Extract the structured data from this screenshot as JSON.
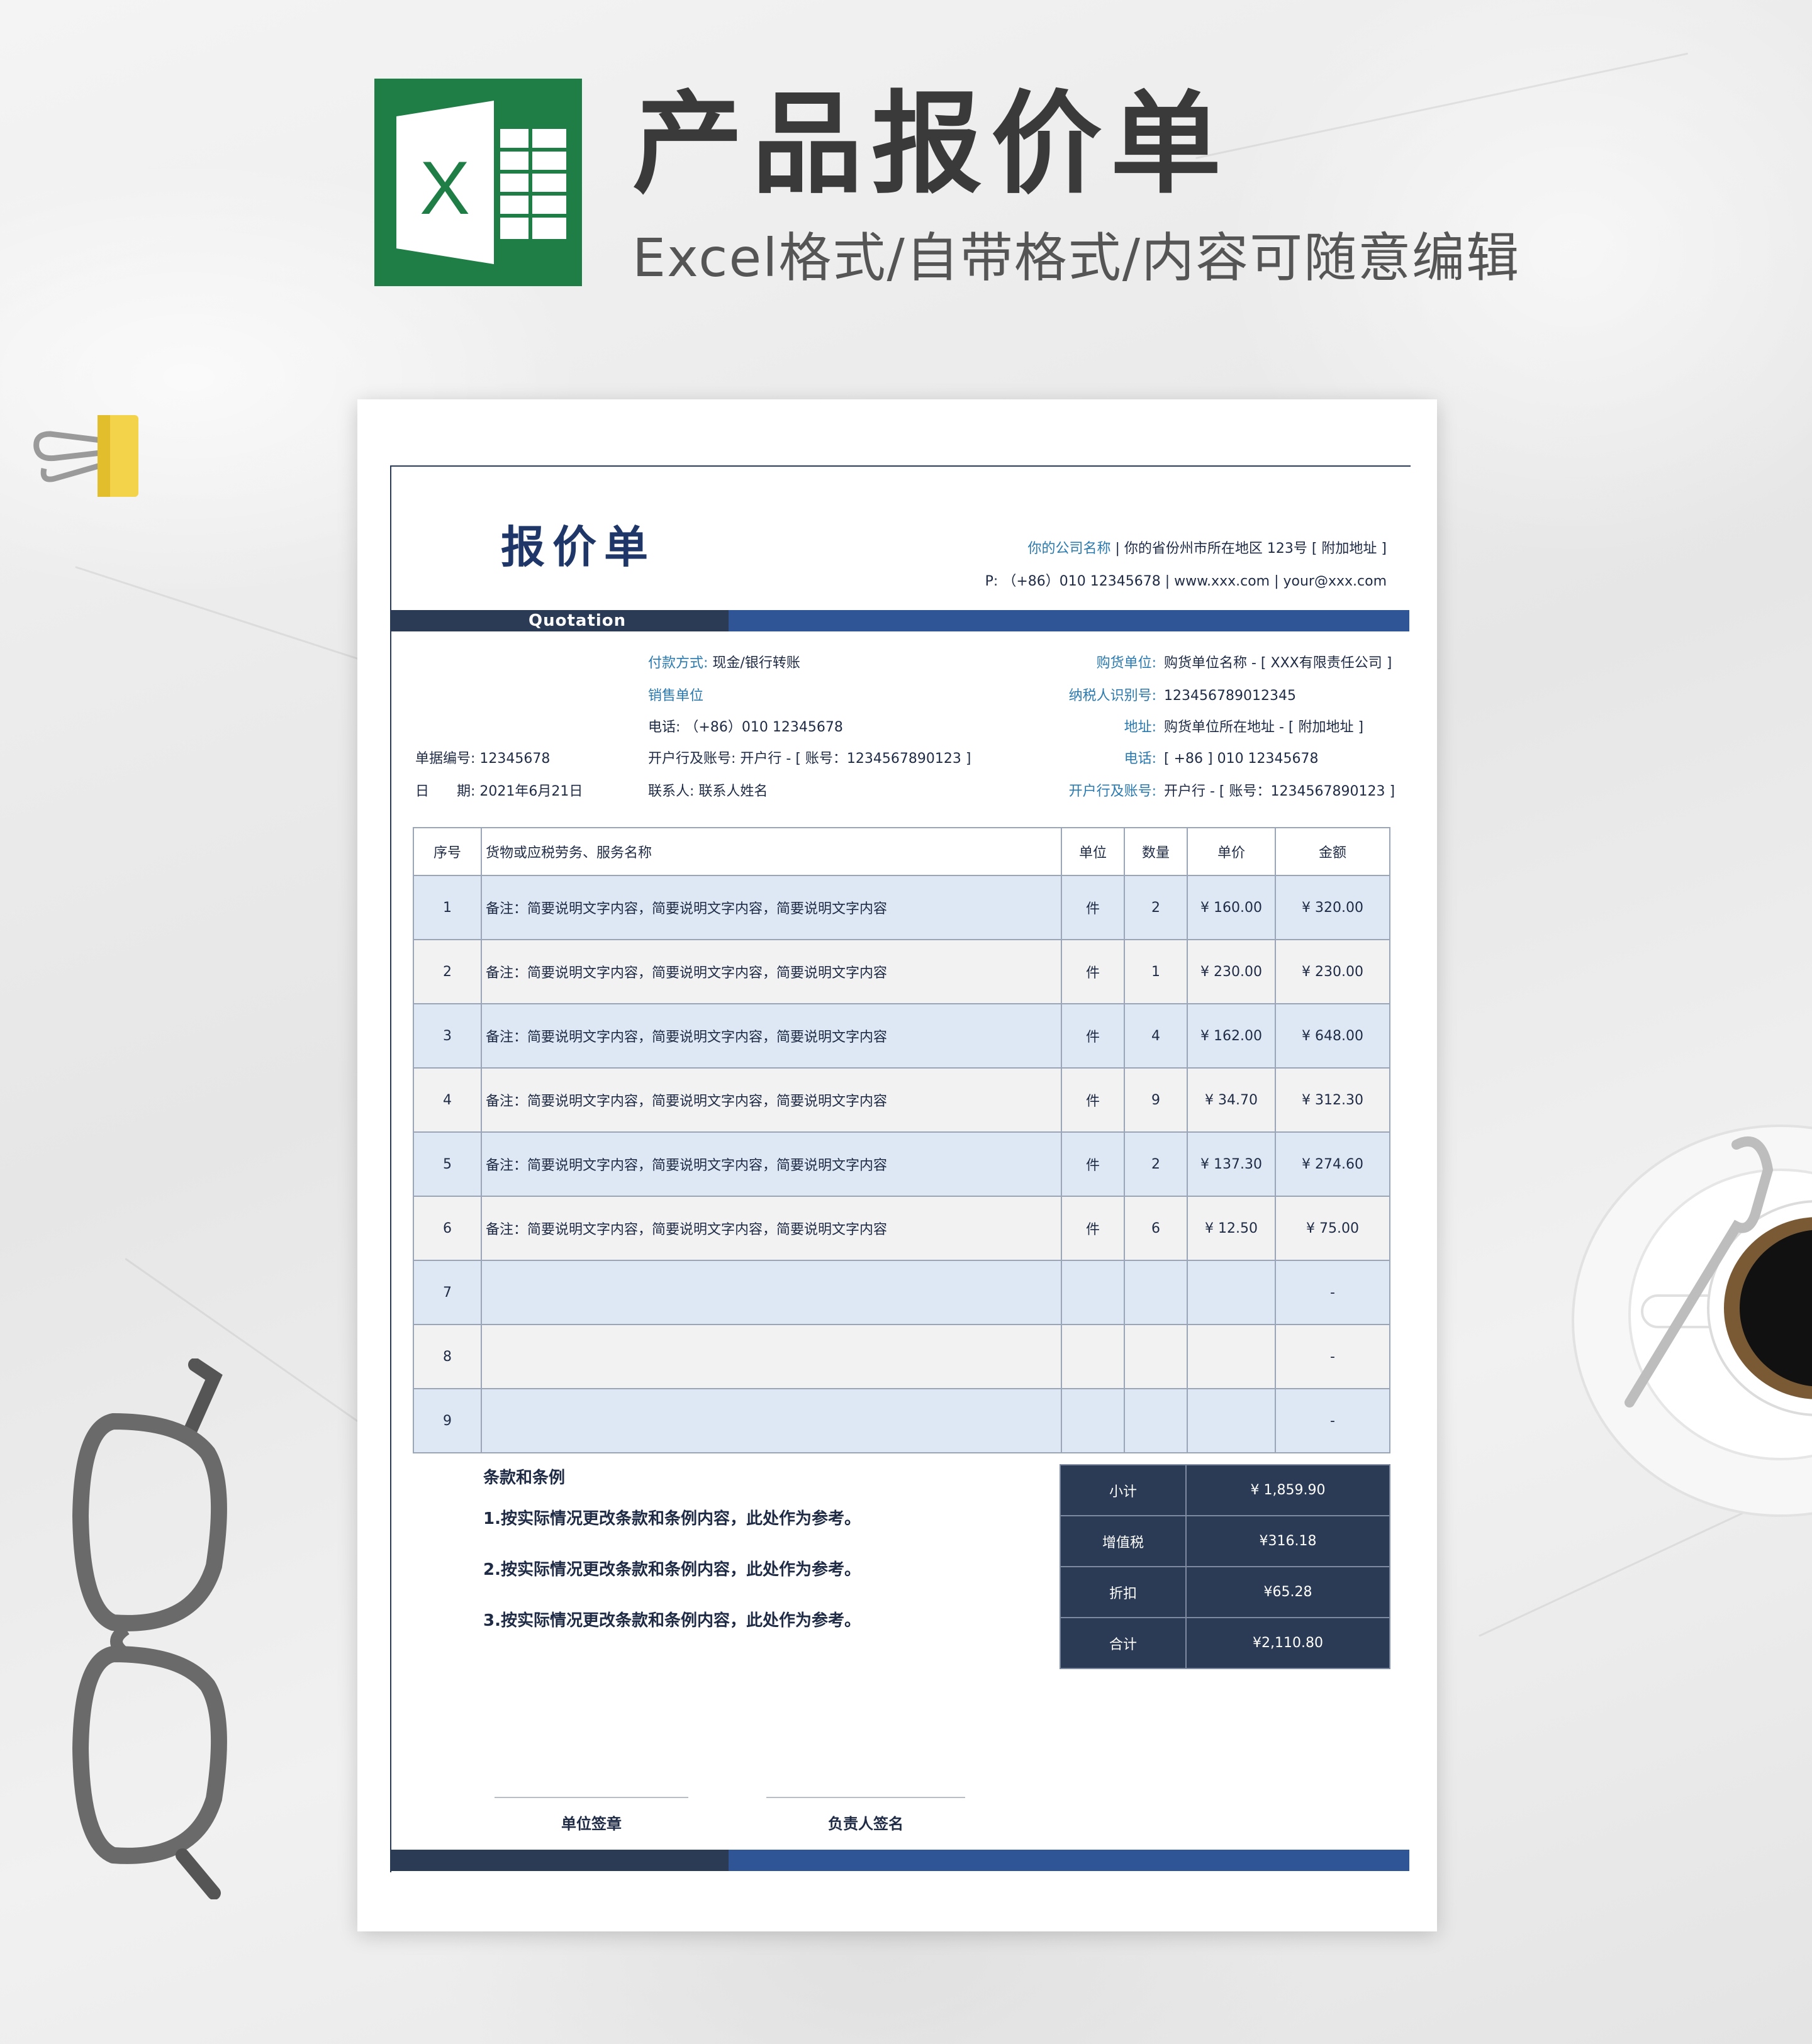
{
  "header": {
    "title": "产品报价单",
    "subtitle": "Excel格式/自带格式/内容可随意编辑",
    "logo_letter": "X"
  },
  "colors": {
    "excel_green": "#1e7e45",
    "navy": "#2b3a55",
    "blue": "#2f5597",
    "accent_text": "#2a7ab0",
    "row_blue": "#dde8f4",
    "row_gray": "#f2f2f2"
  },
  "doc": {
    "title": "报价单",
    "band_label": "Quotation",
    "company": {
      "name": "你的公司名称",
      "address": "| 你的省份州市所在地区 123号 [ 附加地址 ]"
    },
    "contact": "P:  （+86）010 12345678  |  www.xxx.com  |  your@xxx.com"
  },
  "info": {
    "payment_label": "付款方式:",
    "payment_value": "现金/银行转账",
    "seller_label": "销售单位",
    "seller_phone_label": "电话:",
    "seller_phone_value": "（+86）010 12345678",
    "seller_bank_label": "开户行及账号:",
    "seller_bank_value": "开户行 - [ 账号：1234567890123 ]",
    "seller_contact_label": "联系人:",
    "seller_contact_value": "联系人姓名",
    "doc_no_label": "单据编号:",
    "doc_no_value": "12345678",
    "date_label": "日　　期:",
    "date_value": "2021年6月21日",
    "buyer_label": "购货单位:",
    "buyer_value": "购货单位名称 - [ XXX有限责任公司 ]",
    "tax_label": "纳税人识别号:",
    "tax_value": "123456789012345",
    "addr_label": "地址:",
    "addr_value": "购货单位所在地址 - [ 附加地址 ]",
    "buyer_phone_label": "电话:",
    "buyer_phone_value": "[ +86 ] 010 12345678",
    "buyer_bank_label": "开户行及账号:",
    "buyer_bank_value": "开户行 - [ 账号：1234567890123 ]"
  },
  "table": {
    "headers": [
      "序号",
      "货物或应税劳务、服务名称",
      "单位",
      "数量",
      "单价",
      "金额"
    ],
    "rows": [
      [
        "1",
        "备注：简要说明文字内容，简要说明文字内容，简要说明文字内容",
        "件",
        "2",
        "¥ 160.00",
        "¥ 320.00"
      ],
      [
        "2",
        "备注：简要说明文字内容，简要说明文字内容，简要说明文字内容",
        "件",
        "1",
        "¥ 230.00",
        "¥ 230.00"
      ],
      [
        "3",
        "备注：简要说明文字内容，简要说明文字内容，简要说明文字内容",
        "件",
        "4",
        "¥ 162.00",
        "¥ 648.00"
      ],
      [
        "4",
        "备注：简要说明文字内容，简要说明文字内容，简要说明文字内容",
        "件",
        "9",
        "¥ 34.70",
        "¥ 312.30"
      ],
      [
        "5",
        "备注：简要说明文字内容，简要说明文字内容，简要说明文字内容",
        "件",
        "2",
        "¥ 137.30",
        "¥ 274.60"
      ],
      [
        "6",
        "备注：简要说明文字内容，简要说明文字内容，简要说明文字内容",
        "件",
        "6",
        "¥ 12.50",
        "¥ 75.00"
      ],
      [
        "7",
        "",
        "",
        "",
        "",
        "-"
      ],
      [
        "8",
        "",
        "",
        "",
        "",
        "-"
      ],
      [
        "9",
        "",
        "",
        "",
        "",
        "-"
      ]
    ]
  },
  "terms": {
    "title": "条款和条例",
    "lines": [
      "1.按实际情况更改条款和条例内容，此处作为参考。",
      "2.按实际情况更改条款和条例内容，此处作为参考。",
      "3.按实际情况更改条款和条例内容，此处作为参考。"
    ]
  },
  "totals": [
    {
      "label": "小计",
      "value": "¥ 1,859.90"
    },
    {
      "label": "增值税",
      "value": "¥316.18"
    },
    {
      "label": "折扣",
      "value": "¥65.28"
    },
    {
      "label": "合计",
      "value": "¥2,110.80"
    }
  ],
  "signatures": {
    "unit": "单位签章",
    "person": "负责人签名"
  }
}
